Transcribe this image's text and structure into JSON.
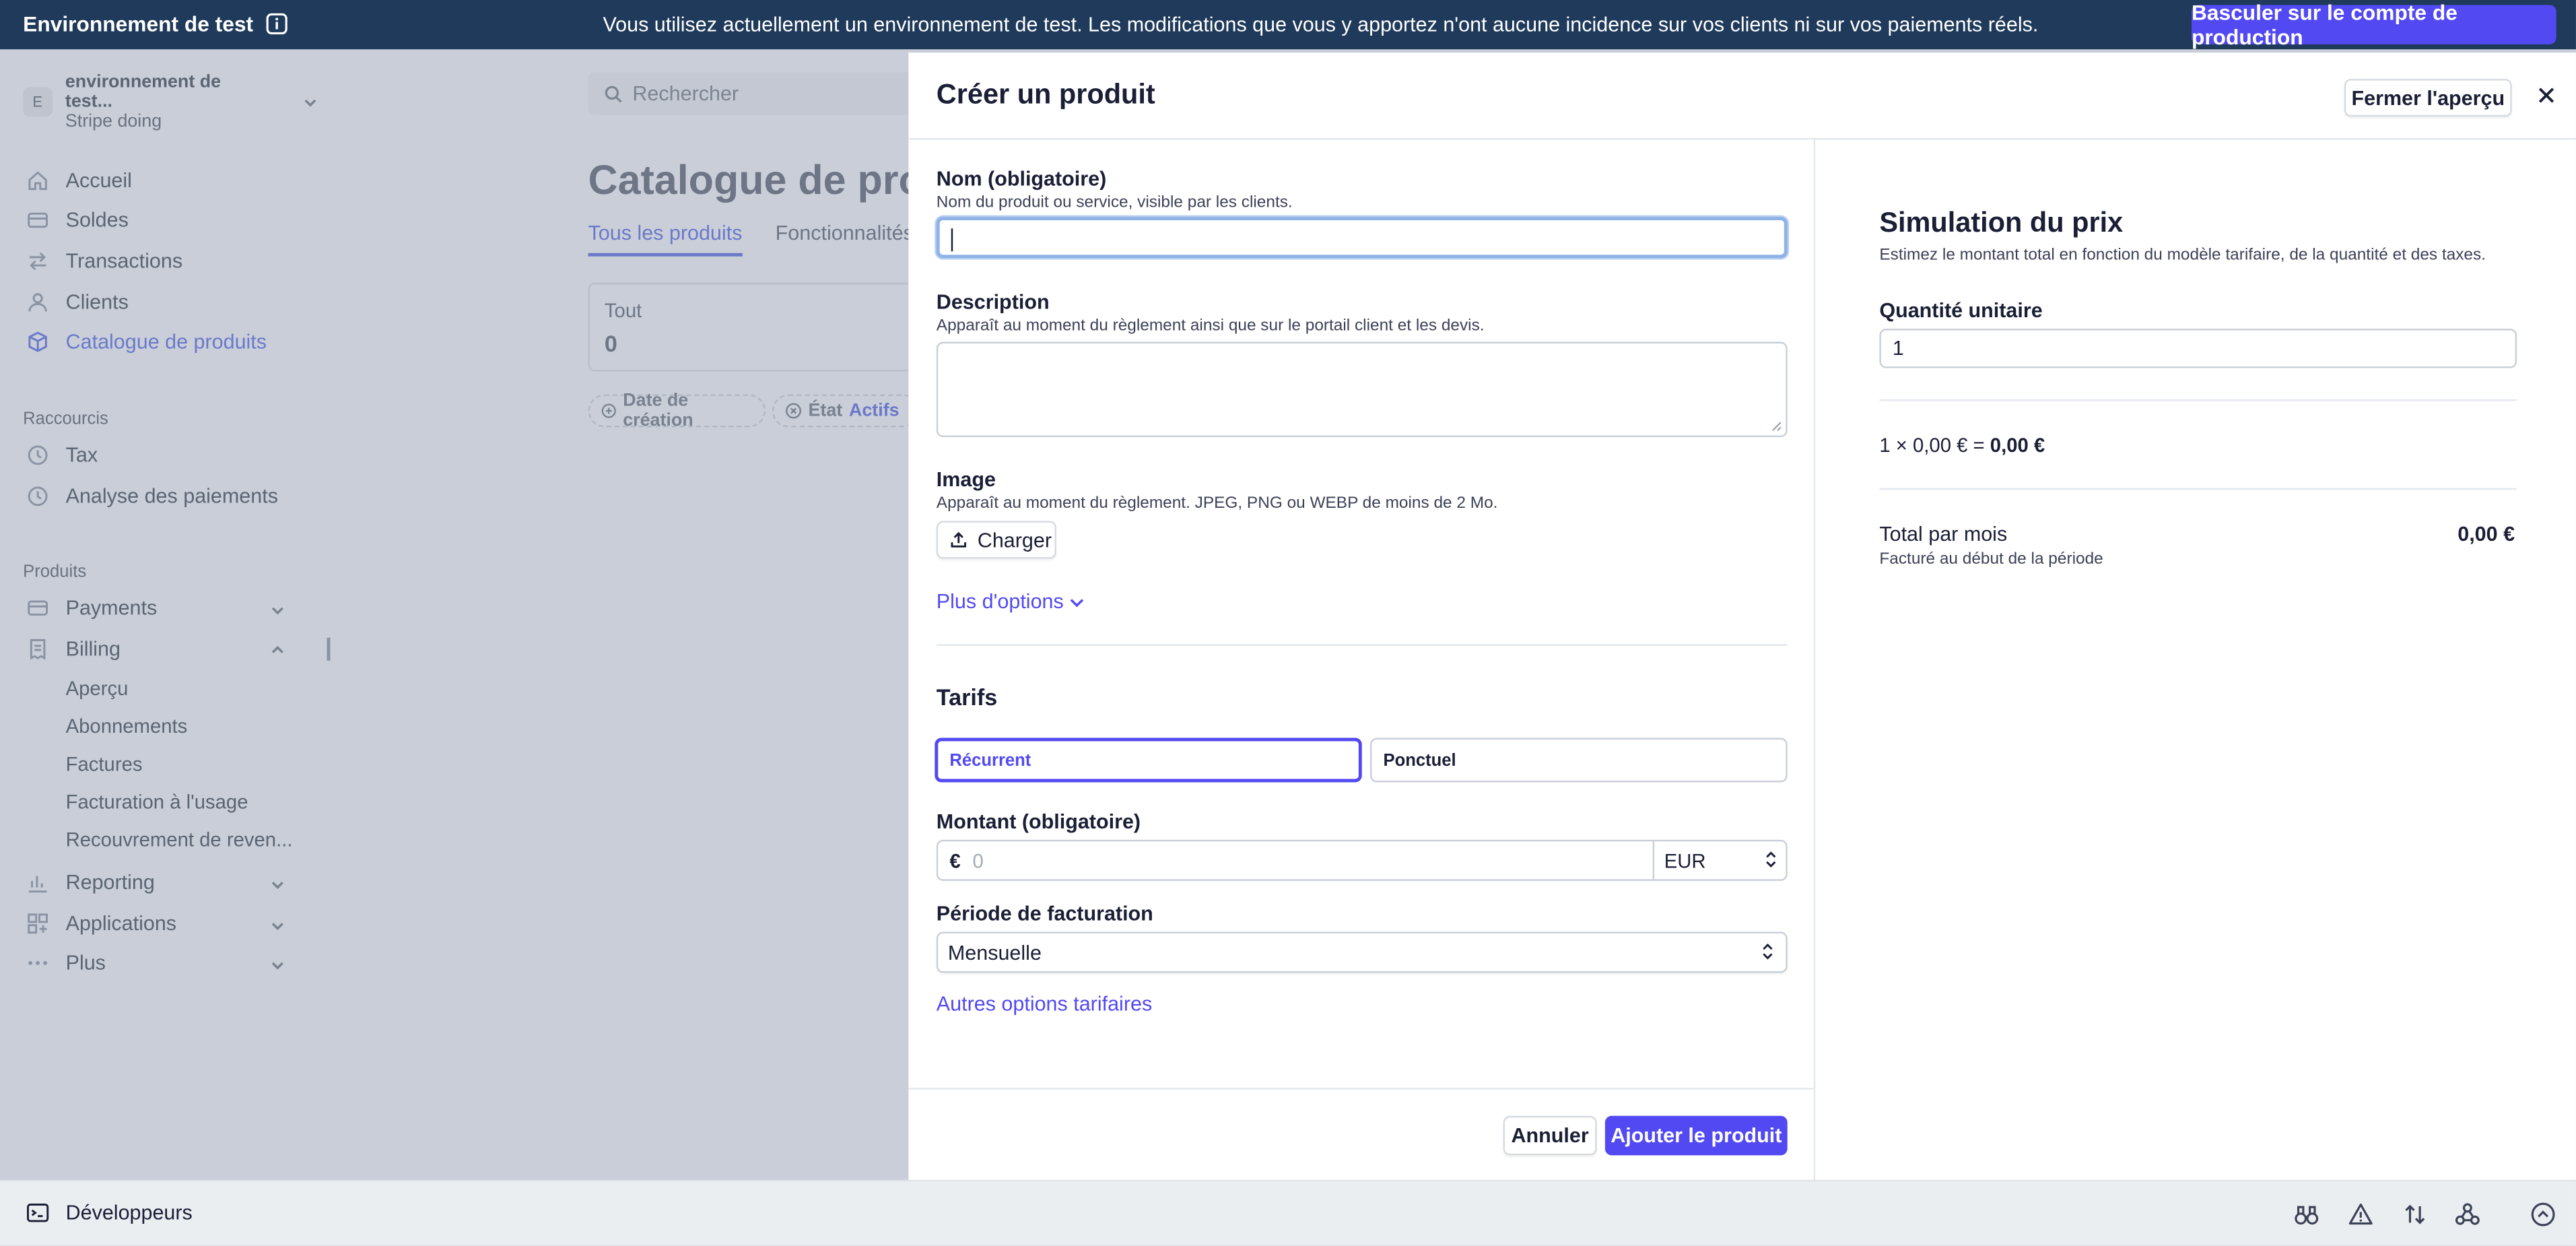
{
  "banner": {
    "env_label": "Environnement de test",
    "message": "Vous utilisez actuellement un environnement de test. Les modifications que vous y apportez n'ont aucune incidence sur vos clients ni sur vos paiements réels.",
    "switch_button": "Basculer sur le compte de production"
  },
  "sidebar": {
    "account_initial": "E",
    "account_name": "environnement de test...",
    "account_sub": "Stripe doing",
    "nav": [
      {
        "label": "Accueil",
        "icon": "home-icon"
      },
      {
        "label": "Soldes",
        "icon": "balance-icon"
      },
      {
        "label": "Transactions",
        "icon": "transactions-icon"
      },
      {
        "label": "Clients",
        "icon": "user-icon"
      },
      {
        "label": "Catalogue de produits",
        "icon": "product-icon",
        "active": true
      }
    ],
    "shortcuts_label": "Raccourcis",
    "shortcuts": [
      {
        "label": "Tax",
        "icon": "clock-icon"
      },
      {
        "label": "Analyse des paiements",
        "icon": "clock-icon"
      }
    ],
    "products_label": "Produits",
    "products": [
      {
        "label": "Payments",
        "icon": "payments-icon"
      },
      {
        "label": "Billing",
        "icon": "billing-icon"
      }
    ],
    "billing_sub": [
      "Aperçu",
      "Abonnements",
      "Factures",
      "Facturation à l'usage",
      "Recouvrement de reven..."
    ],
    "more": [
      {
        "label": "Reporting",
        "icon": "chart-icon"
      },
      {
        "label": "Applications",
        "icon": "apps-icon"
      },
      {
        "label": "Plus",
        "icon": "more-icon"
      }
    ]
  },
  "background": {
    "search_placeholder": "Rechercher",
    "page_title": "Catalogue de prod",
    "tabs": [
      "Tous les produits",
      "Fonctionnalités"
    ],
    "card_label": "Tout",
    "card_value": "0",
    "filters": {
      "created": "Date de création",
      "state": "État",
      "state_value": "Actifs"
    }
  },
  "bottombar": {
    "developers": "Développeurs"
  },
  "modal": {
    "title": "Créer un produit",
    "close_preview": "Fermer l'aperçu",
    "name_label": "Nom (obligatoire)",
    "name_hint": "Nom du produit ou service, visible par les clients.",
    "name_value": "",
    "description_label": "Description",
    "description_hint": "Apparaît au moment du règlement ainsi que sur le portail client et les devis.",
    "image_label": "Image",
    "image_hint": "Apparaît au moment du règlement. JPEG, PNG ou WEBP de moins de 2 Mo.",
    "upload_button": "Charger",
    "more_options": "Plus d'options",
    "pricing_title": "Tarifs",
    "pricing_recurring": "Récurrent",
    "pricing_one_time": "Ponctuel",
    "amount_label": "Montant (obligatoire)",
    "amount_currency_symbol": "€",
    "amount_placeholder": "0",
    "currency": "EUR",
    "period_label": "Période de facturation",
    "period_value": "Mensuelle",
    "other_pricing": "Autres options tarifaires",
    "cancel": "Annuler",
    "add": "Ajouter le produit"
  },
  "simulation": {
    "title": "Simulation du prix",
    "subtitle": "Estimez le montant total en fonction du modèle tarifaire, de la quantité et des taxes.",
    "quantity_label": "Quantité unitaire",
    "quantity_value": "1",
    "equation_prefix": "1 × 0,00 € = ",
    "equation_result": "0,00 €",
    "total_label": "Total par mois",
    "total_value": "0,00 €",
    "total_note": "Facturé au début de la période"
  },
  "colors": {
    "accent": "#5249f2",
    "banner": "#1f3a5a"
  }
}
